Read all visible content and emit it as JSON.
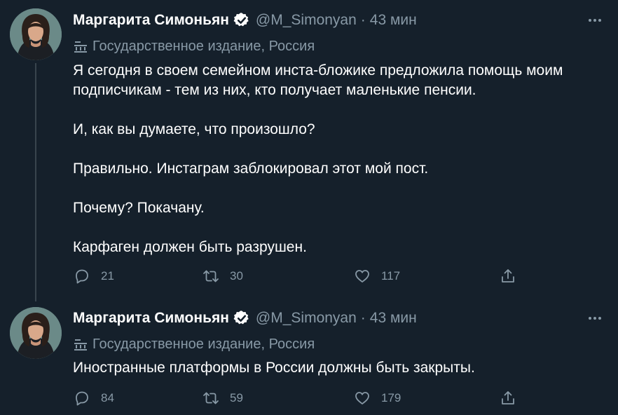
{
  "tweets": [
    {
      "author": {
        "name": "Маргарита Симоньян",
        "handle": "@M_Simonyan",
        "separator": "·",
        "time": "43 мин"
      },
      "label": "Государственное издание, Россия",
      "paragraphs": [
        "Я сегодня в своем семейном инста-бложике предложила помощь моим подписчикам - тем из них, кто получает маленькие пенсии.",
        "И, как вы думаете, что произошло?",
        "Правильно. Инстаграм заблокировал этот мой пост.",
        "Почему? Покачану.",
        "Карфаген должен быть разрушен."
      ],
      "stats": {
        "replies": "21",
        "retweets": "30",
        "likes": "117"
      }
    },
    {
      "author": {
        "name": "Маргарита Симоньян",
        "handle": "@M_Simonyan",
        "separator": "·",
        "time": "43 мин"
      },
      "label": "Государственное издание, Россия",
      "paragraphs": [
        "Иностранные платформы в России должны быть закрыты."
      ],
      "stats": {
        "replies": "84",
        "retweets": "59",
        "likes": "179"
      }
    }
  ],
  "icons": {
    "verified": "verified-badge-icon",
    "more": "more-dots-icon",
    "label": "government-building-icon",
    "reply": "reply-icon",
    "retweet": "retweet-icon",
    "like": "heart-icon",
    "share": "share-icon"
  },
  "colors": {
    "background": "#15202b",
    "text_primary": "#ffffff",
    "text_secondary": "#8899a6",
    "thread_line": "#38444d"
  }
}
